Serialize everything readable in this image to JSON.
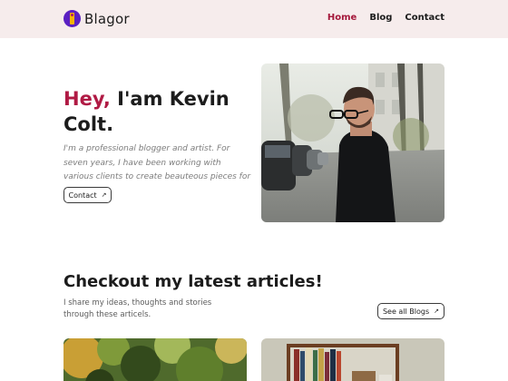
{
  "header": {
    "logo_text": "Blagor",
    "nav": [
      {
        "label": "Home",
        "active": true
      },
      {
        "label": "Blog",
        "active": false
      },
      {
        "label": "Contact",
        "active": false
      }
    ]
  },
  "hero": {
    "title_accent": "Hey,",
    "title_rest": " I'am Kevin Colt.",
    "description": "I'm a professional blogger and artist. For seven years, I have been working with various clients to create beauteous pieces for them.",
    "contact_button": "Contact",
    "arrow_icon": "↗"
  },
  "articles": {
    "title": "Checkout my latest articles!",
    "description": "I share my ideas, thoughts and stories through these articels.",
    "see_all_button": "See all Blogs"
  },
  "colors": {
    "accent": "#b01a44",
    "header_bg": "#f6ecec",
    "logo": "#5a1fc2"
  }
}
